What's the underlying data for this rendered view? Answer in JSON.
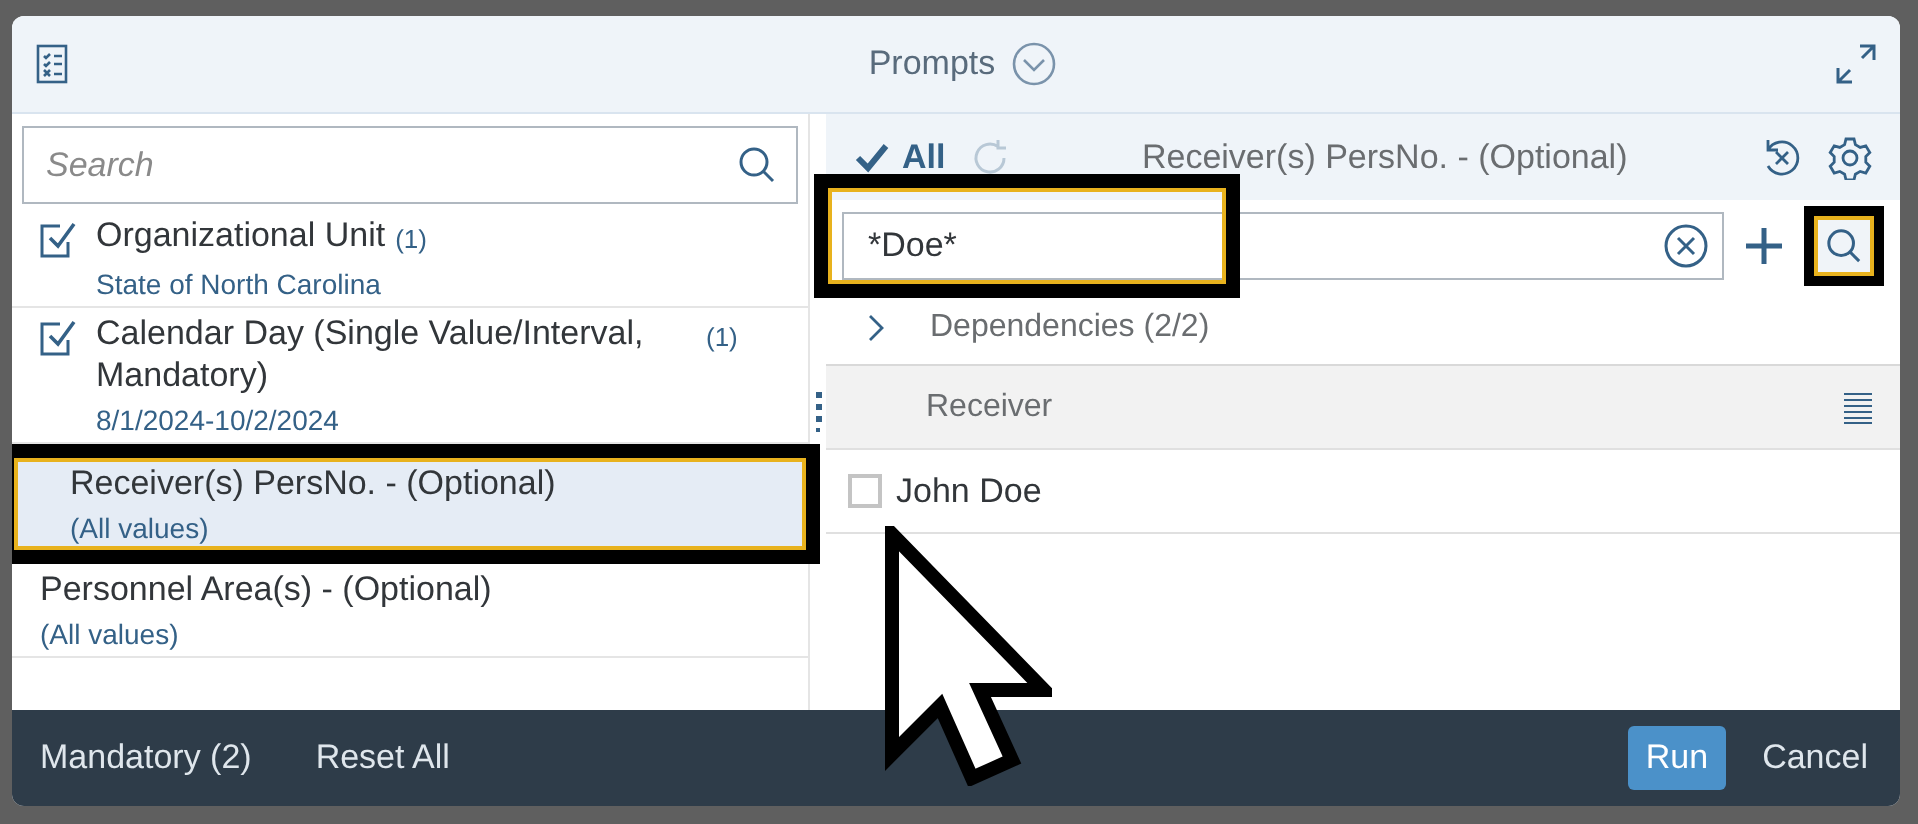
{
  "window": {
    "title": "Prompts"
  },
  "left": {
    "search": {
      "placeholder": "Search"
    },
    "prompts": [
      {
        "title": "Organizational Unit",
        "count": "(1)",
        "value": "State of North Carolina",
        "checked": true,
        "selected": false
      },
      {
        "title": "Calendar Day (Single Value/Interval, Mandatory)",
        "count": "(1)",
        "value": "8/1/2024-10/2/2024",
        "checked": true,
        "selected": false
      },
      {
        "title": "Receiver(s) PersNo. - (Optional)",
        "value": "(All values)",
        "checked": false,
        "selected": true
      },
      {
        "title": "Personnel Area(s) - (Optional)",
        "value": "(All values)",
        "checked": false,
        "selected": false
      }
    ]
  },
  "right": {
    "all_label": "All",
    "title": "Receiver(s) PersNo. - (Optional)",
    "search": {
      "value": "*Doe*"
    },
    "dependencies": {
      "label": "Dependencies (2/2)",
      "expanded": false
    },
    "column": "Receiver",
    "rows": [
      {
        "label": "John Doe",
        "checked": false
      }
    ]
  },
  "footer": {
    "left_buttons": [
      "Mandatory (2)",
      "Reset All"
    ],
    "run": "Run",
    "cancel": "Cancel"
  }
}
